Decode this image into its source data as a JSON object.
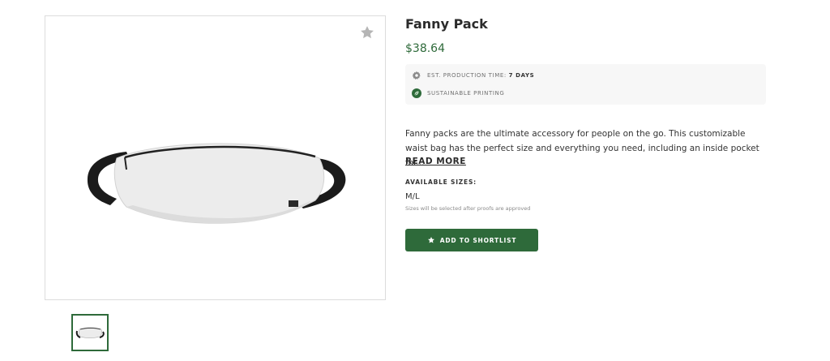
{
  "product": {
    "title": "Fanny Pack",
    "price": "$38.64",
    "info": {
      "production_label": "EST. PRODUCTION TIME:",
      "production_value": "7 DAYS",
      "sustainable_label": "SUSTAINABLE PRINTING"
    },
    "description": "Fanny packs are the ultimate accessory for people on the go. This customizable waist bag has the perfect size and everything you need, including an inside pocket for...",
    "read_more_label": "READ MORE",
    "sizes": {
      "label": "AVAILABLE SIZES:",
      "value": "M/L",
      "note": "Sizes will be selected after proofs are approved"
    },
    "shortlist_button_label": "ADD TO SHORTLIST"
  },
  "icons": {
    "favorite": "star-icon",
    "production": "gear-icon",
    "sustainable": "leaf-icon",
    "shortlist": "star-icon"
  },
  "colors": {
    "accent": "#2e6a3a",
    "price": "#2e6a3a",
    "info_box_bg": "#f7f7f7",
    "border": "#dcdcdc"
  }
}
